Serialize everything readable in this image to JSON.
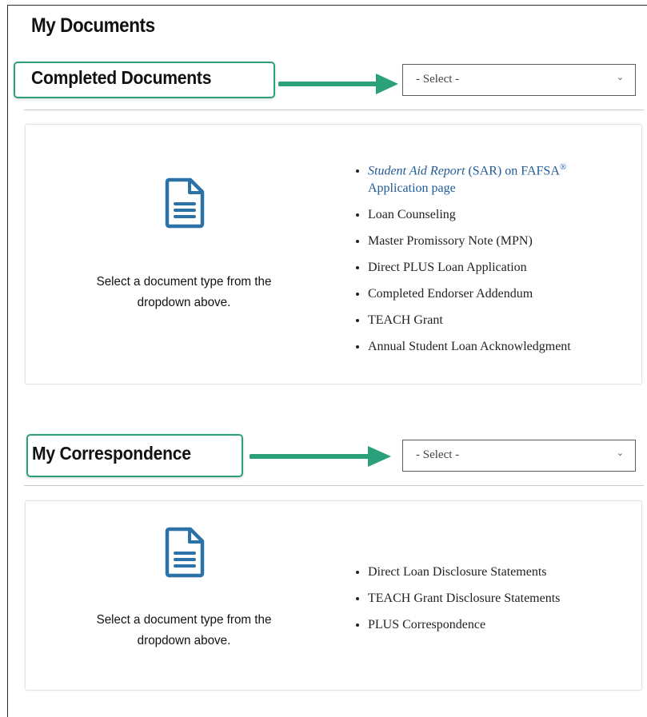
{
  "page": {
    "title": "My Documents"
  },
  "completed_section": {
    "heading": "Completed Documents",
    "select": {
      "value": "- Select -",
      "chevron": "chevron-down-icon"
    },
    "card": {
      "icon": "document-icon",
      "message_line1": "Select a document type from the",
      "message_line2": "dropdown above.",
      "items": [
        {
          "label_italic": "Student Aid Report",
          "label_rest": " (SAR) on FAFSA",
          "label_sup": "®",
          "label_line2": "Application page"
        },
        {
          "label": "Loan Counseling"
        },
        {
          "label": "Master Promissory Note (MPN)"
        },
        {
          "label": "Direct PLUS Loan Application"
        },
        {
          "label": "Completed Endorser Addendum"
        },
        {
          "label": "TEACH Grant"
        },
        {
          "label": "Annual Student Loan Acknowledgment"
        }
      ]
    }
  },
  "correspondence_section": {
    "heading": "My Correspondence",
    "select": {
      "value": "- Select -",
      "chevron": "chevron-down-icon"
    },
    "card": {
      "icon": "document-icon",
      "message_line1": "Select a document type from the",
      "message_line2": "dropdown above.",
      "items": [
        {
          "label": "Direct Loan Disclosure Statements"
        },
        {
          "label": "TEACH Grant Disclosure Statements"
        },
        {
          "label": "PLUS Correspondence"
        }
      ]
    }
  },
  "colors": {
    "highlight_green": "#2aa07b",
    "icon_blue": "#2b72a8",
    "link_blue": "#1f5a96"
  }
}
